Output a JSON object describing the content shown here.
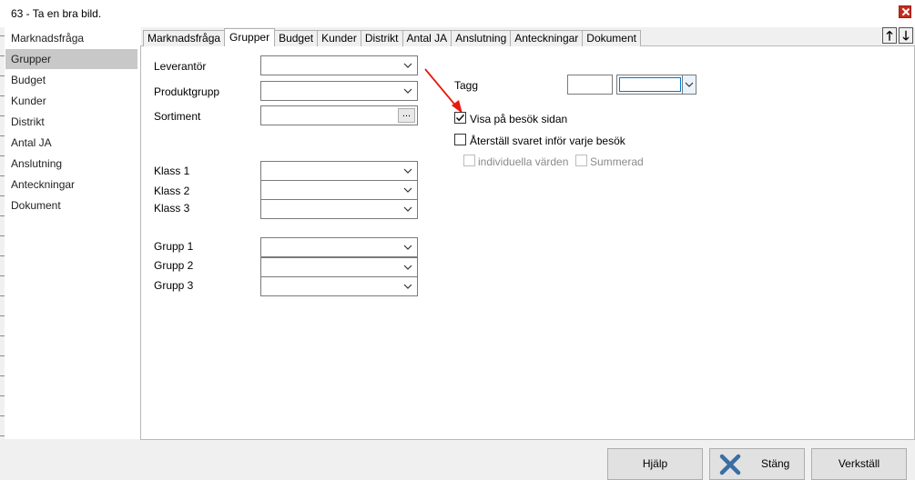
{
  "window": {
    "title": "63 - Ta en bra bild."
  },
  "sidebar": {
    "items": [
      {
        "label": "Marknadsfråga"
      },
      {
        "label": "Grupper",
        "selected": true
      },
      {
        "label": "Budget"
      },
      {
        "label": "Kunder"
      },
      {
        "label": "Distrikt"
      },
      {
        "label": "Antal JA"
      },
      {
        "label": "Anslutning"
      },
      {
        "label": "Anteckningar"
      },
      {
        "label": "Dokument"
      }
    ]
  },
  "tabs": [
    {
      "label": "Marknadsfråga"
    },
    {
      "label": "Grupper",
      "active": true
    },
    {
      "label": "Budget"
    },
    {
      "label": "Kunder"
    },
    {
      "label": "Distrikt"
    },
    {
      "label": "Antal JA"
    },
    {
      "label": "Anslutning"
    },
    {
      "label": "Anteckningar"
    },
    {
      "label": "Dokument"
    }
  ],
  "nav_arrows": {
    "up": "🡑",
    "down": "🡓"
  },
  "form": {
    "leverantor": {
      "label": "Leverantör",
      "value": ""
    },
    "produktgrupp": {
      "label": "Produktgrupp",
      "value": ""
    },
    "sortiment": {
      "label": "Sortiment",
      "value": "",
      "browse": "..."
    },
    "klass1": {
      "label": "Klass 1",
      "value": ""
    },
    "klass2": {
      "label": "Klass 2",
      "value": ""
    },
    "klass3": {
      "label": "Klass 3",
      "value": ""
    },
    "grupp1": {
      "label": "Grupp 1",
      "value": ""
    },
    "grupp2": {
      "label": "Grupp 2",
      "value": ""
    },
    "grupp3": {
      "label": "Grupp 3",
      "value": ""
    },
    "tagg": {
      "label": "Tagg",
      "value": "",
      "select_value": ""
    },
    "visa_pa_besok": {
      "label": "Visa på besök sidan",
      "checked": true
    },
    "aterstall": {
      "label": "Återställ svaret inför varje besök",
      "checked": false
    },
    "individuella": {
      "label": "individuella värden",
      "checked": false,
      "enabled": false
    },
    "summerad": {
      "label": "Summerad",
      "checked": false,
      "enabled": false
    }
  },
  "buttons": {
    "help": "Hjälp",
    "close": "Stäng",
    "apply": "Verkställ"
  },
  "colors": {
    "annotation_arrow": "#e8190f",
    "close_icon": "#3a6ea5"
  }
}
